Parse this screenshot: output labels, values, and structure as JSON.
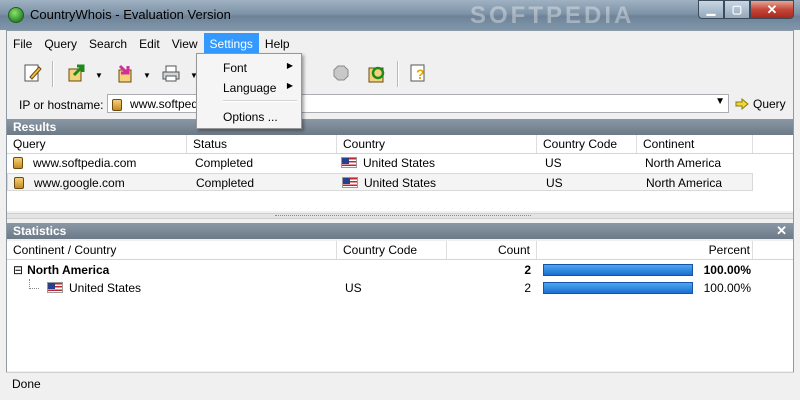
{
  "window": {
    "title": "CountryWhois - Evaluation Version",
    "watermark": "SOFTPEDIA",
    "minimize_glyph": "▁",
    "maximize_glyph": "▢",
    "close_glyph": "✕"
  },
  "menubar": {
    "items": [
      "File",
      "Query",
      "Search",
      "Edit",
      "View",
      "Settings",
      "Help"
    ],
    "active": "Settings"
  },
  "settings_menu": {
    "items": [
      "Font",
      "Language",
      "Options ..."
    ]
  },
  "address_bar": {
    "label": "IP or hostname:",
    "value": "www.softpedia.com",
    "query_label": "Query"
  },
  "results": {
    "title": "Results",
    "columns": [
      "Query",
      "Status",
      "Country",
      "Country Code",
      "Continent"
    ],
    "rows": [
      {
        "query": "www.softpedia.com",
        "status": "Completed",
        "country": "United States",
        "code": "US",
        "continent": "North America"
      },
      {
        "query": "www.google.com",
        "status": "Completed",
        "country": "United States",
        "code": "US",
        "continent": "North America"
      }
    ]
  },
  "statistics": {
    "title": "Statistics",
    "close_glyph": "✕",
    "columns": [
      "Continent / Country",
      "Country Code",
      "Count",
      "Percent"
    ],
    "rows": [
      {
        "name": "North America",
        "code": "",
        "count": "2",
        "percent": "100.00%",
        "percent_value": 100,
        "expanded": true,
        "expand_glyph": "⊟"
      },
      {
        "name": "United States",
        "code": "US",
        "count": "2",
        "percent": "100.00%",
        "percent_value": 100
      }
    ]
  },
  "status_bar": {
    "text": "Done"
  },
  "colors": {
    "menu_highlight": "#3399ff",
    "panel_header": "#7a8794",
    "progress_bar": "#2b85e0"
  }
}
